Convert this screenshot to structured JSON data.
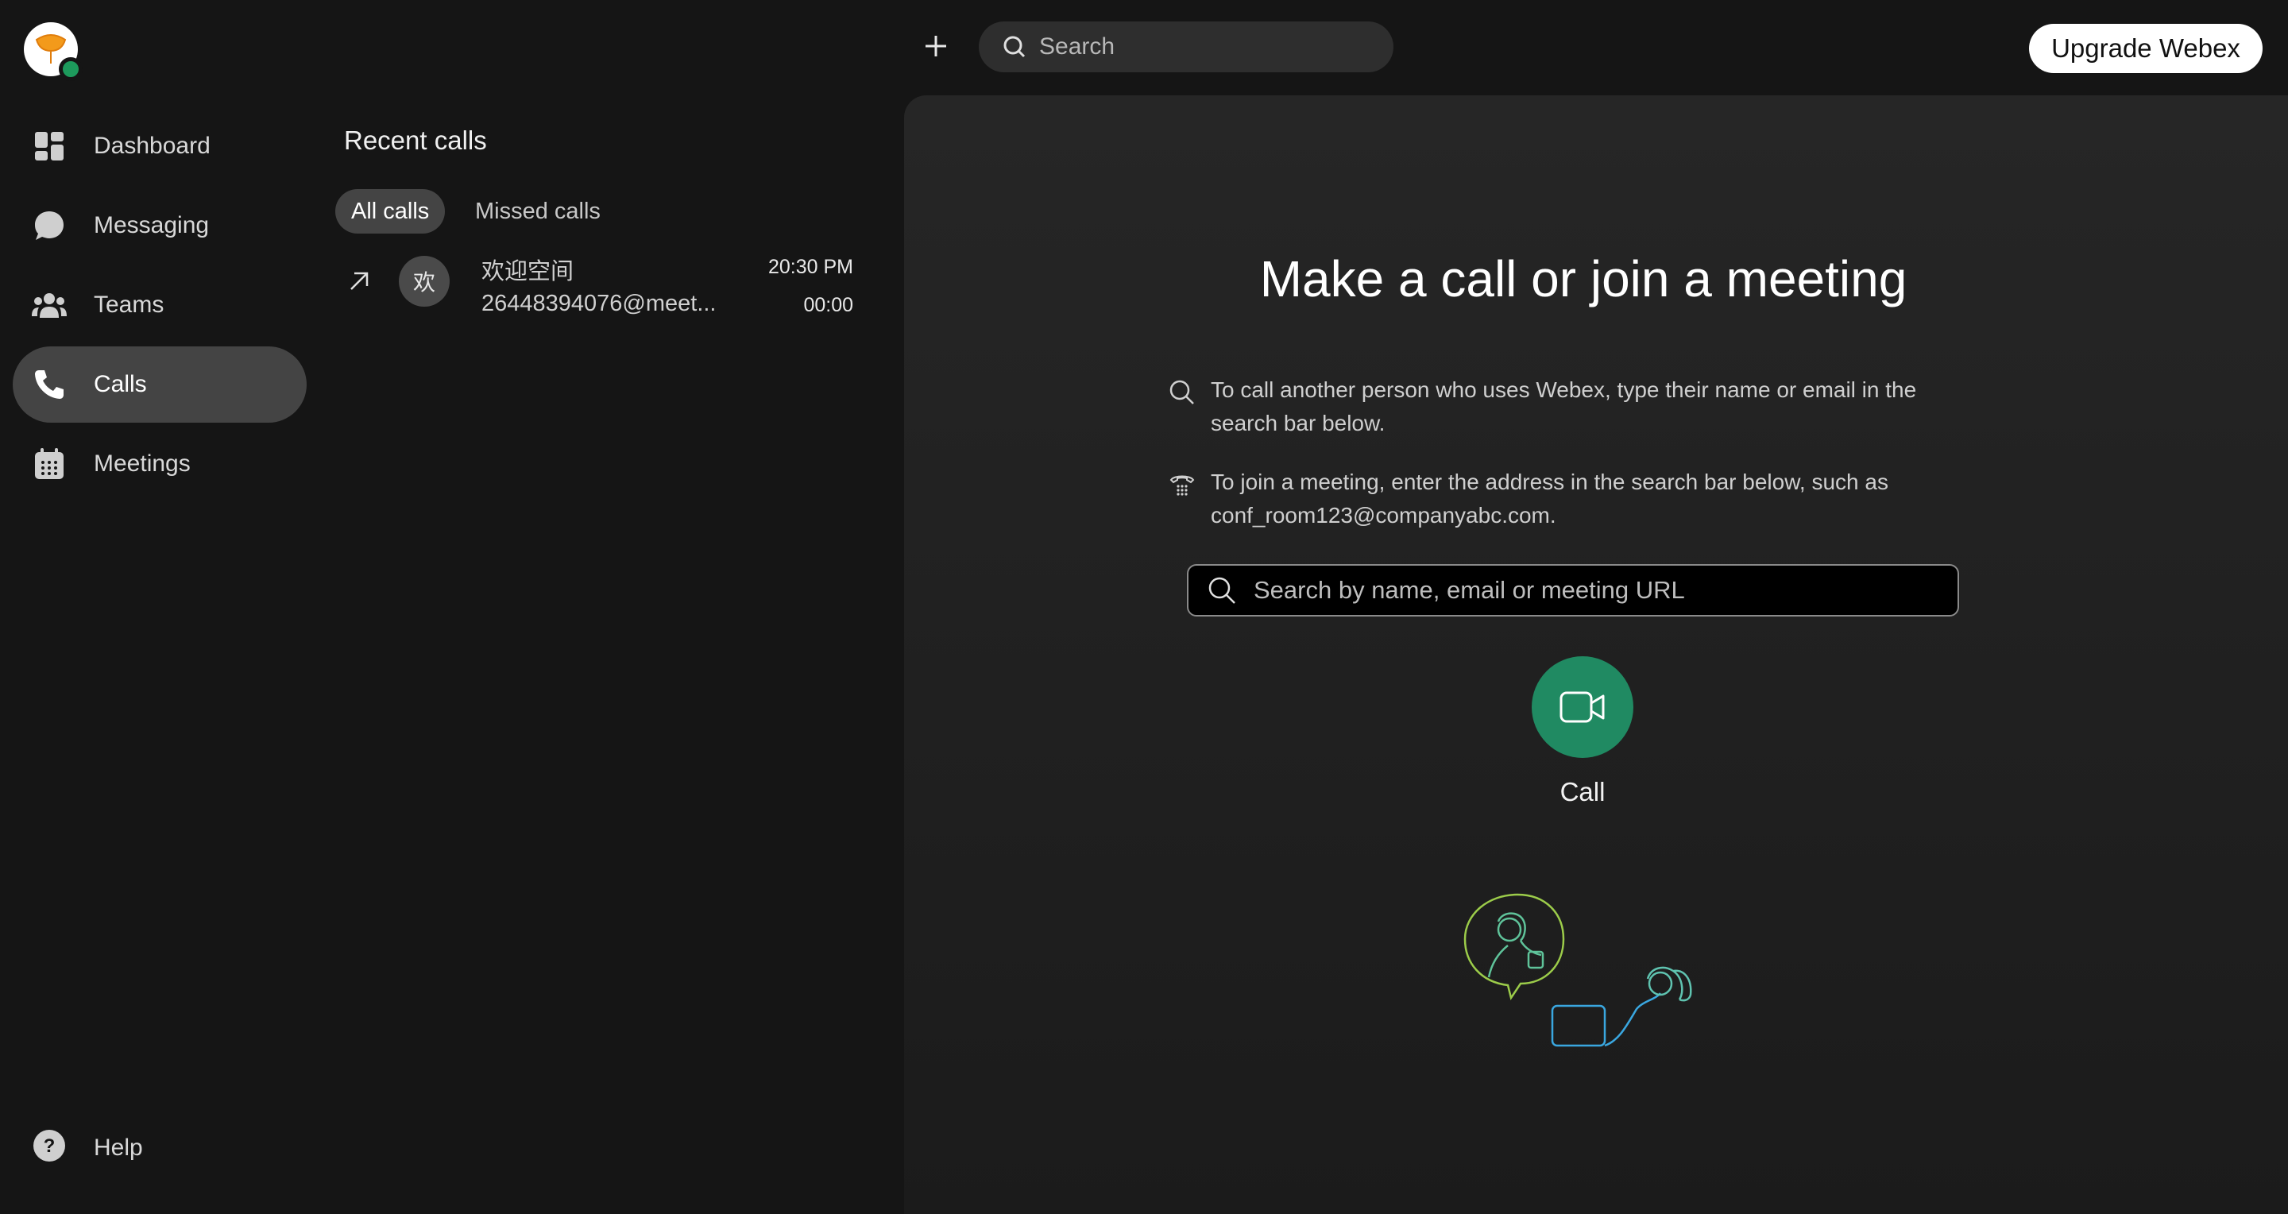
{
  "topbar": {
    "search_placeholder": "Search",
    "upgrade_label": "Upgrade Webex"
  },
  "sidebar": {
    "items": [
      {
        "label": "Dashboard",
        "icon": "dashboard-icon"
      },
      {
        "label": "Messaging",
        "icon": "chat-bubble-icon"
      },
      {
        "label": "Teams",
        "icon": "people-icon"
      },
      {
        "label": "Calls",
        "icon": "phone-icon",
        "active": true
      },
      {
        "label": "Meetings",
        "icon": "calendar-icon"
      }
    ],
    "help_label": "Help"
  },
  "recent": {
    "title": "Recent calls",
    "filters": [
      {
        "label": "All calls",
        "active": true
      },
      {
        "label": "Missed calls",
        "active": false
      }
    ],
    "calls": [
      {
        "avatar": "欢",
        "name": "欢迎空间",
        "address": "26448394076@meet...",
        "time": "20:30 PM",
        "duration": "00:00",
        "direction_icon": "outgoing-arrow-icon"
      }
    ]
  },
  "main": {
    "title": "Make a call or join a meeting",
    "hint_call": "To call another person who uses Webex, type their name or email in the search bar below.",
    "hint_meeting": "To join a meeting, enter the address in the search bar below, such as conf_room123@companyabc.com.",
    "search_placeholder": "Search by name, email or meeting URL",
    "call_label": "Call"
  },
  "colors": {
    "background": "#151515",
    "panel": "#262626",
    "accent_green": "#208a62",
    "presence_green": "#1d9a5c",
    "active_nav": "#444444"
  }
}
